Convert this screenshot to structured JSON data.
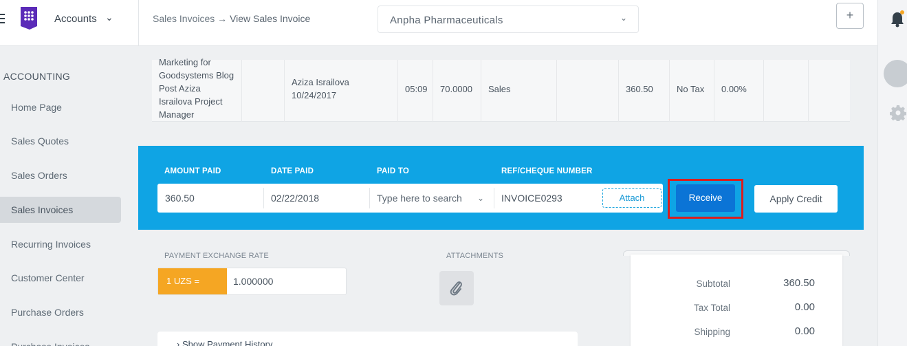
{
  "app": {
    "name": "Accounts"
  },
  "breadcrumb": {
    "parent": "Sales Invoices",
    "sep": "→",
    "current": "View Sales Invoice"
  },
  "company_select": {
    "value": "Anpha Pharmaceuticals"
  },
  "add_button": {
    "label": "+"
  },
  "sidebar": {
    "section": "ACCOUNTING",
    "items": [
      {
        "label": "Home Page"
      },
      {
        "label": "Sales Quotes"
      },
      {
        "label": "Sales Orders"
      },
      {
        "label": "Sales Invoices"
      },
      {
        "label": "Recurring Invoices"
      },
      {
        "label": "Customer Center"
      },
      {
        "label": "Purchase Orders"
      },
      {
        "label": "Purchase Invoices"
      }
    ]
  },
  "line_item": {
    "description": [
      "Marketing for",
      "Goodsystems Blog",
      "Post Aziza",
      "Israilova Project",
      "Manager"
    ],
    "person": "Aziza Israilova",
    "date": "10/24/2017",
    "hours": "05:09",
    "rate": "70.0000",
    "account": "Sales",
    "amount": "360.50",
    "tax": "No Tax",
    "tax_rate": "0.00%"
  },
  "payment": {
    "labels": {
      "amount_paid": "AMOUNT PAID",
      "date_paid": "DATE PAID",
      "paid_to": "PAID TO",
      "ref": "REF/CHEQUE NUMBER"
    },
    "amount_paid": "360.50",
    "date_paid": "02/22/2018",
    "paid_to_placeholder": "Type here to search",
    "ref": "INVOICE0293",
    "attach_label": "Attach",
    "receive_label": "Receive",
    "apply_credit_label": "Apply Credit"
  },
  "exchange": {
    "label": "PAYMENT EXCHANGE RATE",
    "currency": "1 UZS =",
    "value": "1.000000"
  },
  "attachments": {
    "label": "ATTACHMENTS"
  },
  "totals": {
    "subtotal_label": "Subtotal",
    "subtotal": "360.50",
    "tax_label": "Tax Total",
    "tax": "0.00",
    "shipping_label": "Shipping",
    "shipping": "0.00"
  },
  "history": {
    "label": "Show Payment History"
  },
  "colors": {
    "accent": "#0fa4e4",
    "primary_button": "#0b74d6",
    "highlight": "#d81e1e",
    "rate_tag": "#f5a623"
  }
}
